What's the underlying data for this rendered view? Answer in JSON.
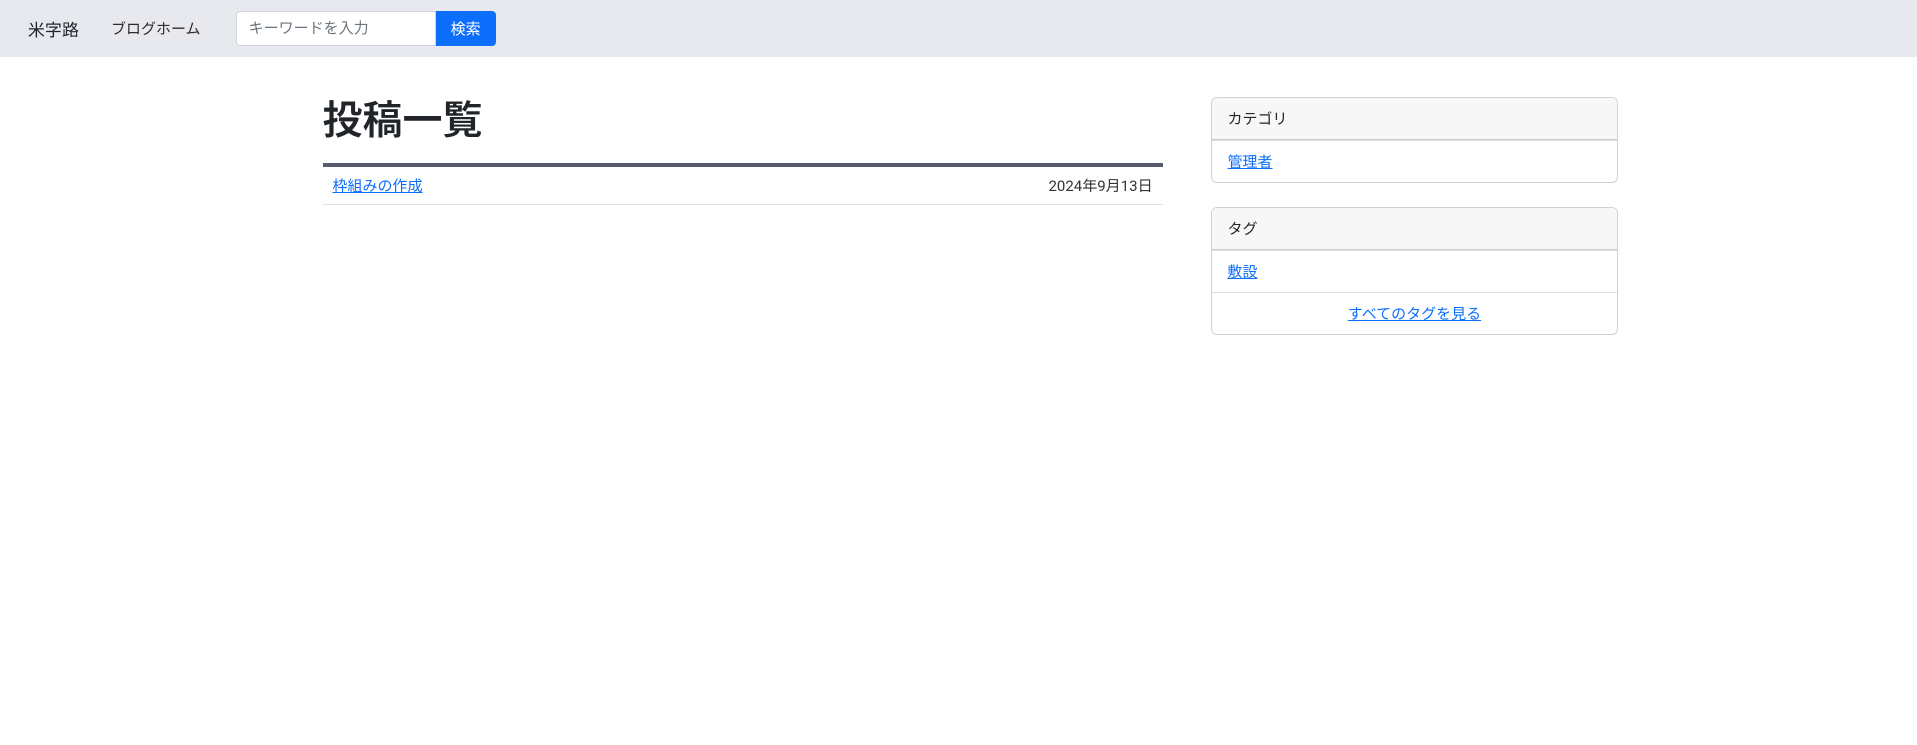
{
  "nav": {
    "brand": "米字路",
    "home": "ブログホーム",
    "search_placeholder": "キーワードを入力",
    "search_button": "検索"
  },
  "main": {
    "title": "投稿一覧",
    "posts": [
      {
        "title": "枠組みの作成",
        "date": "2024年9月13日"
      }
    ]
  },
  "sidebar": {
    "categories": {
      "header": "カテゴリ",
      "items": [
        {
          "label": "管理者"
        }
      ]
    },
    "tags": {
      "header": "タグ",
      "items": [
        {
          "label": "敷設"
        }
      ],
      "all_link": "すべてのタグを見る"
    }
  }
}
